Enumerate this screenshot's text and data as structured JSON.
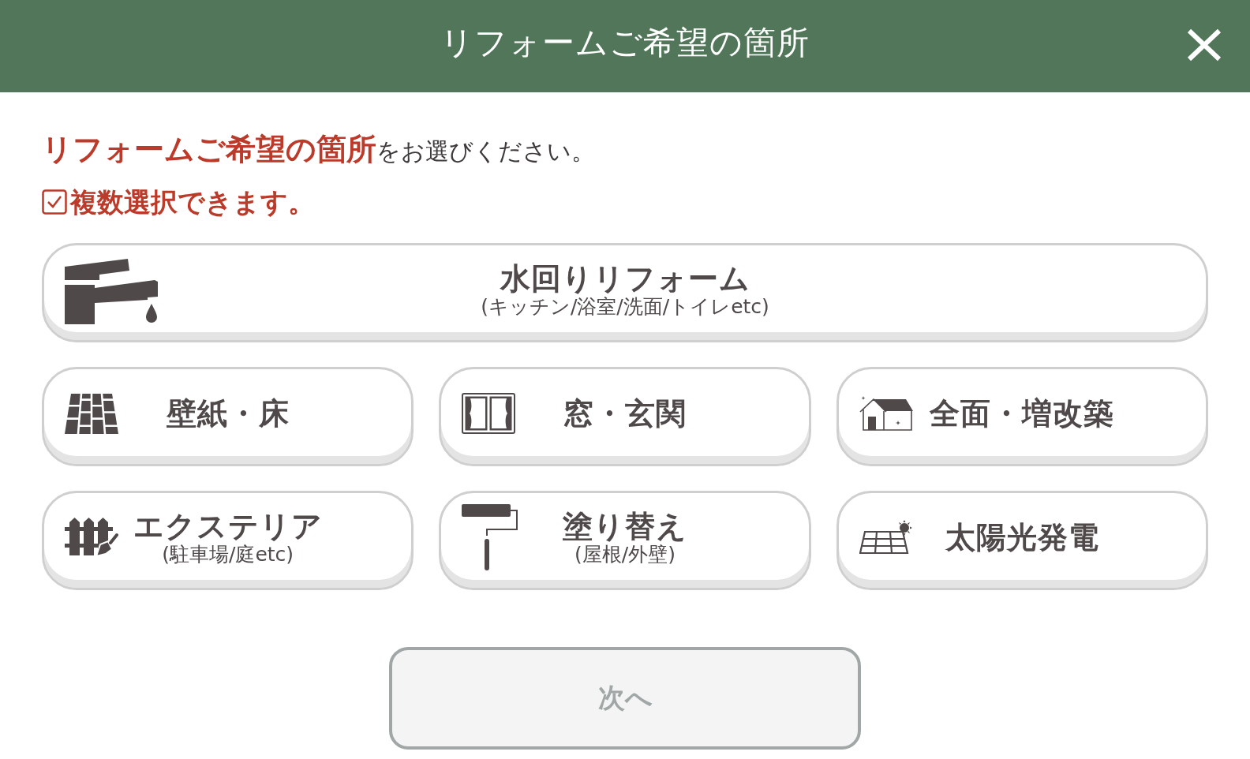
{
  "header": {
    "title": "リフォームご希望の箇所"
  },
  "instruction": "**リフォームご希望の箇所**をお選びください。",
  "note": "複数選択できます。",
  "main_option": {
    "kind": "plumbing",
    "label": "水回りリフォーム",
    "sublabel": "(キッチン/浴室/洗面/トイレetc)",
    "selected": false
  },
  "options": [
    {
      "kind": "wallpaper",
      "label": "壁紙・床",
      "selected": false
    },
    {
      "kind": "window",
      "label": "窓・玄関",
      "selected": false
    },
    {
      "kind": "house",
      "label": "全面・増改築",
      "selected": false
    },
    {
      "kind": "exterior",
      "label": "エクステリア",
      "sublabel": "(駐車場/庭etc)",
      "selected": false
    },
    {
      "kind": "painting",
      "label": "塗り替え",
      "sublabel": "(屋根/外壁)",
      "selected": false
    },
    {
      "kind": "solar",
      "label": "太陽光発電",
      "selected": false
    }
  ],
  "next_button": {
    "label": "次へ",
    "disabled": true
  }
}
